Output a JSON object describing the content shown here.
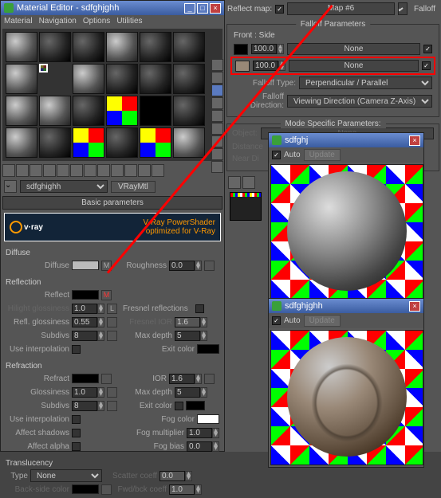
{
  "editor": {
    "title": "Material Editor - sdfghjghh",
    "menu": [
      "Material",
      "Navigation",
      "Options",
      "Utilities"
    ],
    "mat_name": "sdfghighh",
    "mat_type": "VRayMtl"
  },
  "rollups": {
    "basic": "Basic parameters"
  },
  "vray": {
    "brand": "v·ray",
    "tagline1": "V-Ray PowerShader",
    "tagline2": "optimized for V-Ray"
  },
  "diffuse": {
    "title": "Diffuse",
    "diffuse_lbl": "Diffuse",
    "m_btn": "M",
    "roughness_lbl": "Roughness",
    "roughness": "0.0"
  },
  "reflection": {
    "title": "Reflection",
    "reflect_lbl": "Reflect",
    "l_btn": "L",
    "hilight_lbl": "Hilight glossiness",
    "hilight": "1.0",
    "fresnel_lbl": "Fresnel reflections",
    "refl_gloss_lbl": "Refl. glossiness",
    "refl_gloss": "0.55",
    "fresnel_ior_lbl": "Fresnel IOR",
    "fresnel_ior": "1.6",
    "subdivs_lbl": "Subdivs",
    "subdivs": "8",
    "maxdepth_lbl": "Max depth",
    "maxdepth": "5",
    "useinterp_lbl": "Use interpolation",
    "exitcolor_lbl": "Exit color"
  },
  "refraction": {
    "title": "Refraction",
    "refract_lbl": "Refract",
    "ior_lbl": "IOR",
    "ior": "1.6",
    "gloss_lbl": "Glossiness",
    "gloss": "1.0",
    "maxdepth_lbl": "Max depth",
    "maxdepth": "5",
    "subdivs_lbl": "Subdivs",
    "subdivs": "8",
    "exitcolor_lbl": "Exit color",
    "useinterp_lbl": "Use interpolation",
    "fogcolor_lbl": "Fog color",
    "affectshadows_lbl": "Affect shadows",
    "fogmult_lbl": "Fog multiplier",
    "fogmult": "1.0",
    "affectalpha_lbl": "Affect alpha",
    "fogbias_lbl": "Fog bias",
    "fogbias": "0.0"
  },
  "trans": {
    "title": "Translucency",
    "type_lbl": "Type",
    "type": "None",
    "scatter_lbl": "Scatter coeff",
    "scatter": "0.0",
    "backside_lbl": "Back-side color",
    "fwdbck_lbl": "Fwd/bck coeff",
    "fwdbck": "1.0"
  },
  "right": {
    "reflectmap_lbl": "Reflect map:",
    "map_name": "Map #6",
    "map_type": "Falloff",
    "falloff_title": "Falloff Parameters",
    "frontside": "Front : Side",
    "val1": "100.0",
    "val2": "100.0",
    "none": "None",
    "ftype_lbl": "Falloff Type:",
    "ftype": "Perpendicular / Parallel",
    "fdir_lbl": "Falloff Direction:",
    "fdir": "Viewing Direction (Camera Z-Axis)",
    "modespec": "Mode Specific Parameters:",
    "object": "Object:",
    "distance": "Distance",
    "neardist": "Near Di"
  },
  "preview1": {
    "title": "sdfghj",
    "auto": "Auto",
    "update": "Update"
  },
  "preview2": {
    "title": "sdfghjghh",
    "auto": "Auto",
    "update": "Update"
  }
}
